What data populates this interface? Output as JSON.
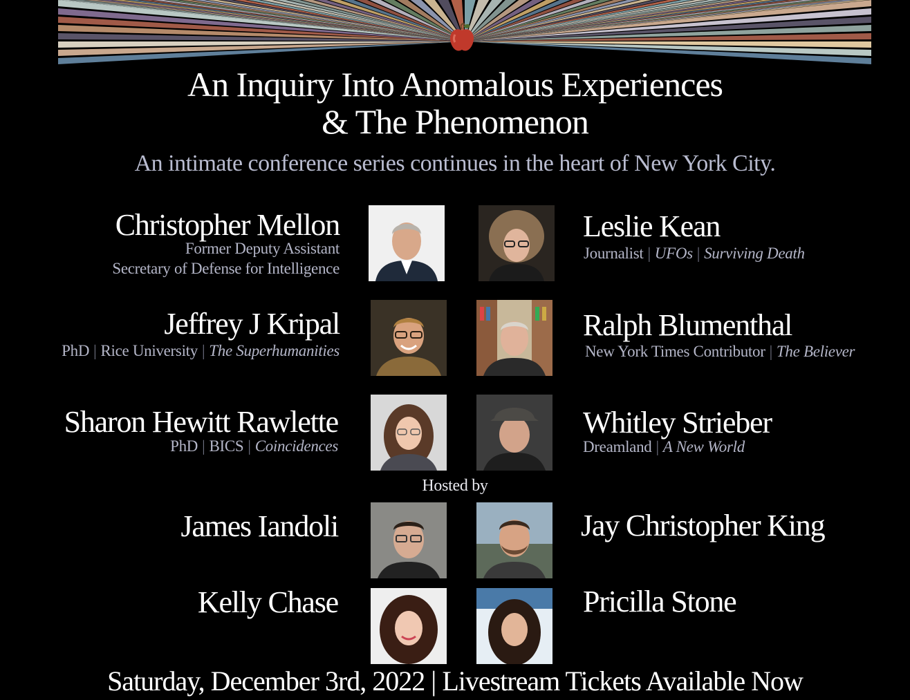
{
  "header": {
    "title_line1": "An Inquiry Into Anomalous Experiences",
    "title_line2": "& The Phenomenon",
    "subtitle": "An intimate conference series continues in the heart of New York City.",
    "logo_icon": "apple-icon"
  },
  "speakers": {
    "mellon": {
      "name": "Christopher Mellon",
      "desc_line1": "Former Deputy Assistant",
      "desc_line2": "Secretary of Defense for Intelligence"
    },
    "kean": {
      "name": "Leslie Kean",
      "desc_a": "Journalist",
      "desc_b": "UFOs",
      "desc_c": "Surviving Death"
    },
    "kripal": {
      "name": "Jeffrey J Kripal",
      "desc_a": "PhD",
      "desc_b": "Rice University",
      "desc_c": "The Superhumanities"
    },
    "blumenthal": {
      "name": "Ralph Blumenthal",
      "desc_a": "New York Times Contributor",
      "desc_b": "The Believer"
    },
    "rawlette": {
      "name": "Sharon Hewitt Rawlette",
      "desc_a": "PhD",
      "desc_b": "BICS",
      "desc_c": "Coincidences"
    },
    "strieber": {
      "name": "Whitley Strieber",
      "desc_a": "Dreamland",
      "desc_b": "A New World"
    }
  },
  "hosts": {
    "label": "Hosted by",
    "iandoli": {
      "name": "James Iandoli"
    },
    "king": {
      "name": "Jay Christopher King"
    },
    "chase": {
      "name": "Kelly Chase"
    },
    "stone": {
      "name": "Pricilla Stone"
    }
  },
  "separator": "|",
  "footer": {
    "text": "Saturday, December 3rd, 2022 | Livestream Tickets Available Now"
  },
  "colors": {
    "background": "#000000",
    "subtitle": "#b9bcd0",
    "description": "#b4b6c8",
    "apple": "#c0392b"
  }
}
